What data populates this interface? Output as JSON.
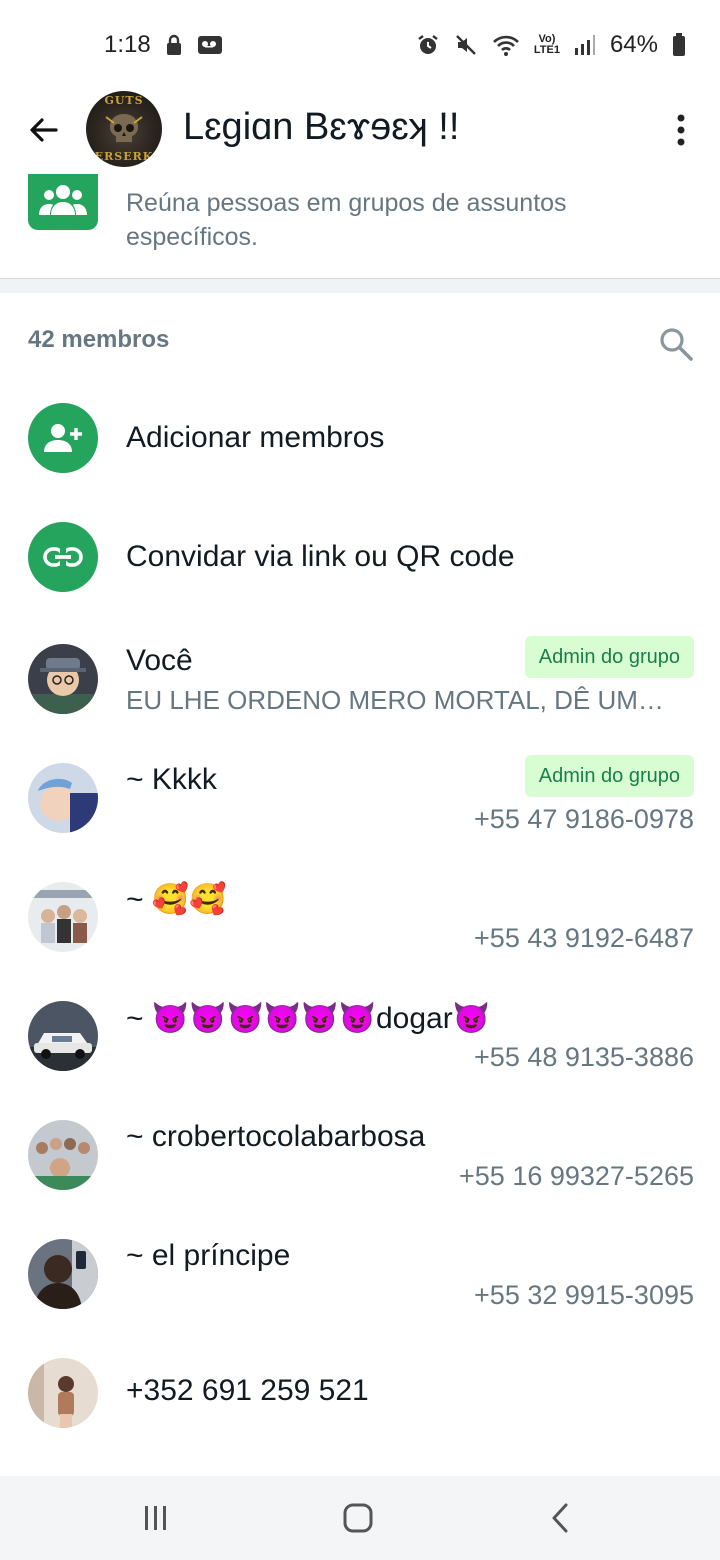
{
  "status_bar": {
    "time": "1:18",
    "battery": "64%",
    "network_label_top": "Vo)",
    "network_label_bottom": "LTE1"
  },
  "header": {
    "back_icon": "arrow-left-icon",
    "group_name": "Lɛgiɑn Bɛɤɘɛʞ  !!",
    "avatar_text_top": "GUTS",
    "avatar_text_bottom": "ERSERK",
    "menu_icon": "more-vert-icon"
  },
  "community": {
    "description": "Reúna pessoas em grupos de assuntos específicos."
  },
  "members": {
    "count_label": "42 membros",
    "actions": [
      {
        "label": "Adicionar membros",
        "icon": "add-person-icon"
      },
      {
        "label": "Convidar via link ou QR code",
        "icon": "link-icon"
      }
    ],
    "list": [
      {
        "name": "Você",
        "badge": "Admin do grupo",
        "status": "EU LHE ORDENO MERO MORTAL, DÊ UM…"
      },
      {
        "name": "~ Kkkk",
        "badge": "Admin do grupo",
        "phone": "+55 47 9186-0978"
      },
      {
        "name": "~ 🥰🥰",
        "phone": "+55 43 9192-6487"
      },
      {
        "name": "~ 😈😈😈😈😈😈dogar😈",
        "phone": "+55 48 9135-3886"
      },
      {
        "name": "~ crobertocolabarbosa",
        "phone": "+55 16 99327-5265"
      },
      {
        "name": "~ el príncipe",
        "phone": "+55 32 9915-3095"
      },
      {
        "name": "+352 691 259 521"
      }
    ]
  },
  "colors": {
    "accent": "#25a45e",
    "badge_bg": "#d9fdd3",
    "badge_text": "#1a7f4b",
    "secondary_text": "#667781"
  }
}
